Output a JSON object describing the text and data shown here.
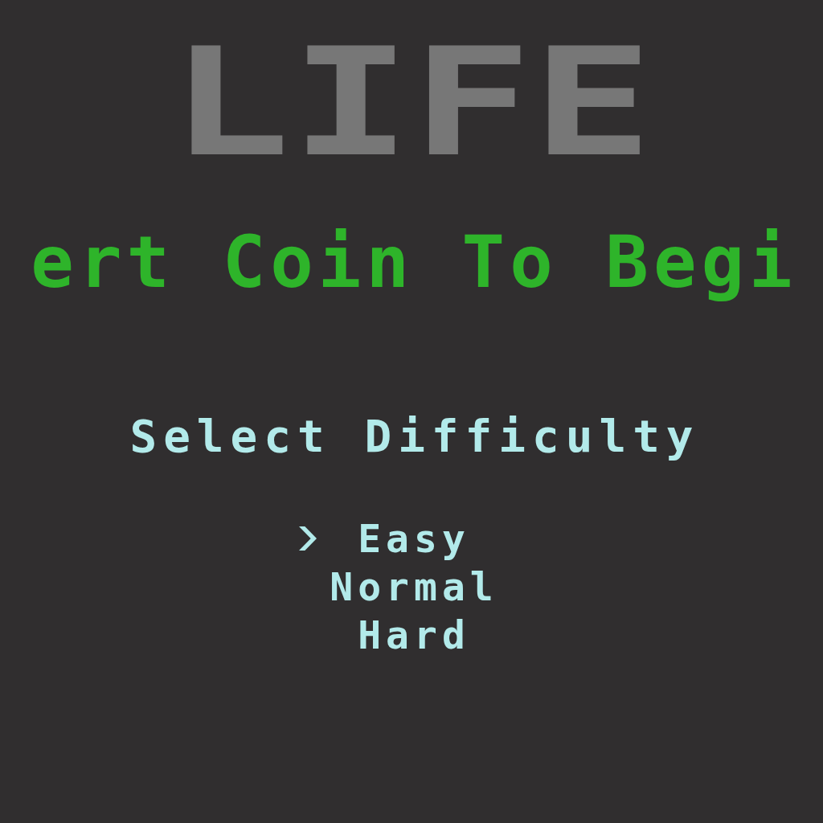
{
  "title": {
    "text": "LIFE"
  },
  "prompt": {
    "text": "ert Coin To Begi"
  },
  "difficulty": {
    "heading": "Select Difficulty",
    "options": [
      {
        "label": "Easy",
        "selected": true
      },
      {
        "label": "Normal",
        "selected": false
      },
      {
        "label": "Hard",
        "selected": false
      }
    ]
  }
}
